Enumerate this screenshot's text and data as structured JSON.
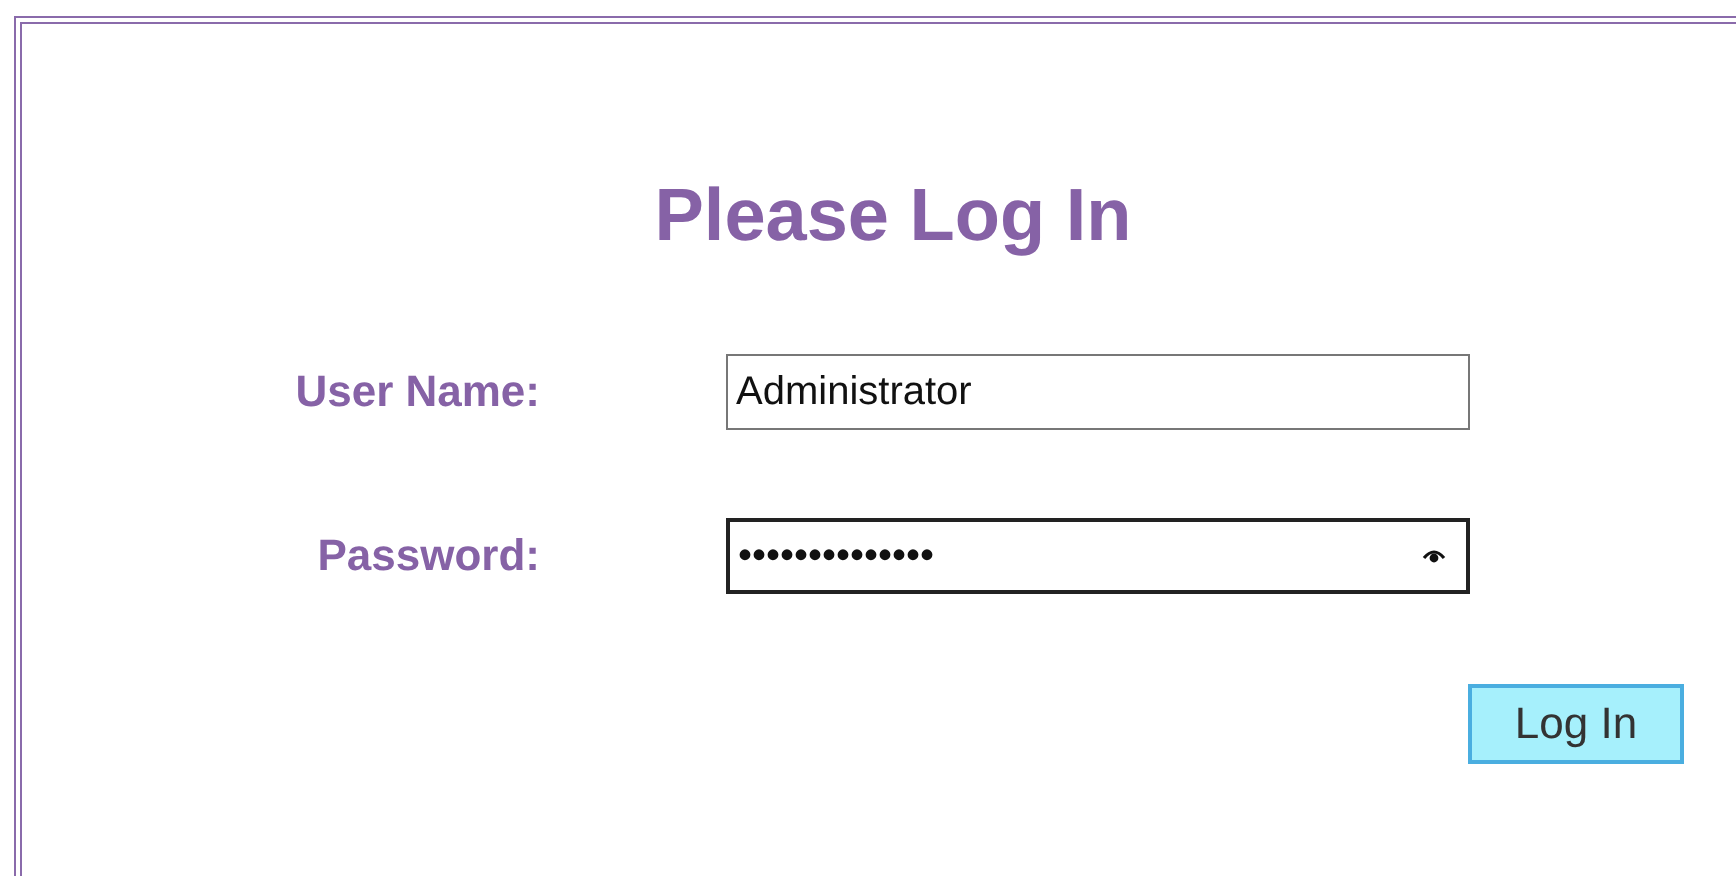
{
  "title": "Please Log In",
  "fields": [
    {
      "kind": "text",
      "label": "User Name:",
      "value": "Administrator",
      "focused": false
    },
    {
      "kind": "password",
      "label": "Password:",
      "value": "••••••••••••••",
      "focused": true
    }
  ],
  "submit": {
    "label": "Log In"
  }
}
